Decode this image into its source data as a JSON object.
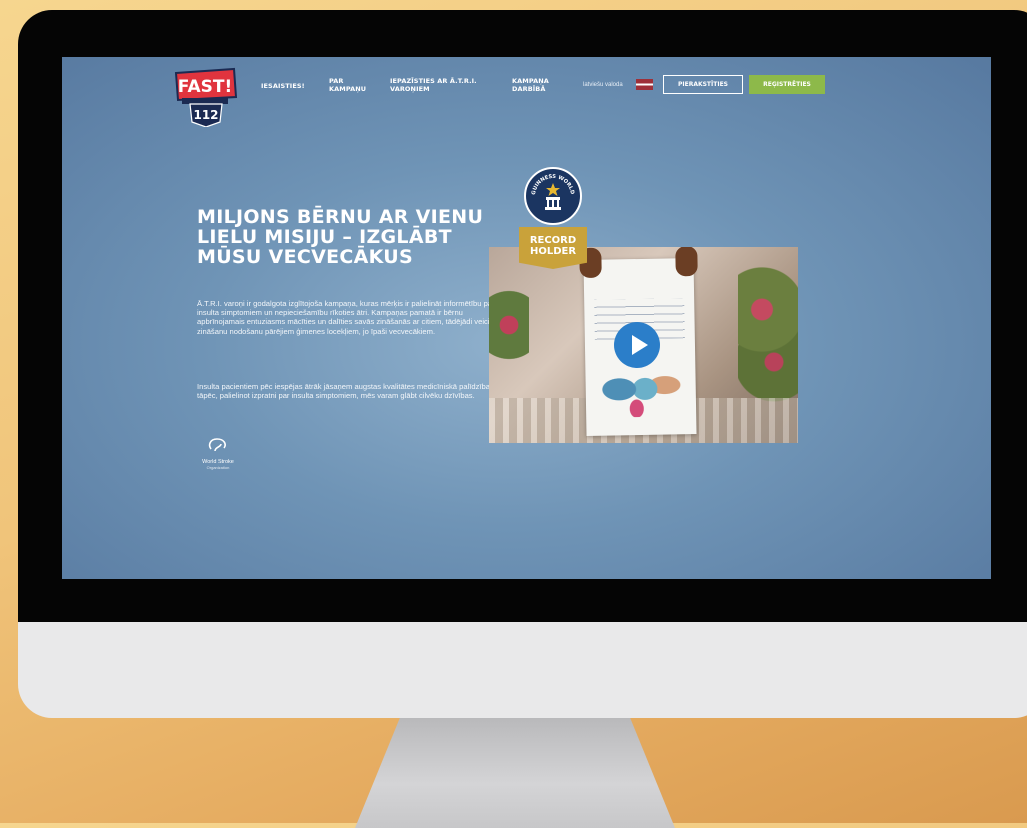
{
  "nav": {
    "items": [
      "IESAISTIES!",
      "PAR KAMPAŅU",
      "IEPAZĪSTIES AR Ā.T.R.I. VAROŅIEM",
      "KAMPAŅA DARBĪBĀ"
    ],
    "language_label": "latviešu valoda",
    "login_label": "PIERAKSTĪTIES",
    "register_label": "REĢISTRĒTIES"
  },
  "logo": {
    "text": "FAST!",
    "subtext": "112"
  },
  "hero": {
    "headline": "MILJONS BĒRNU AR VIENU LIELU MISIJU – IZGLĀBT MŪSU VECVECĀKUS",
    "paragraph1": "Ā.T.R.I. varoņi ir godalgota izglītojoša kampaņa, kuras mērķis ir palielināt informētību par insulta simptomiem un nepieciešamību rīkoties ātri. Kampaņas pamatā ir bērnu apbrīnojamais entuziasms mācīties un dalīties savās zināšanās ar citiem, tādējādi veicinot zināšanu nodošanu pārējiem ģimenes locekļiem, jo īpaši vecvecākiem.",
    "paragraph2": "Insulta pacientiem pēc iespējas ātrāk jāsaņem augstas kvalitātes medicīniskā palīdzība, tāpēc, palielinot izpratni par insulta simptomiem, mēs varam glābt cilvēku dzīvības."
  },
  "partner": {
    "name": "World Stroke",
    "sub": "Organization"
  },
  "badge": {
    "gwr_text": "GUINNESS WORLD RECORDS",
    "record_label": "RECORD HOLDER"
  },
  "colors": {
    "screen_bg": "#6f94b6",
    "register_green": "#8db94a",
    "play_blue": "#2b7ec9",
    "record_gold": "#c9a23a",
    "logo_red": "#e0343e"
  }
}
